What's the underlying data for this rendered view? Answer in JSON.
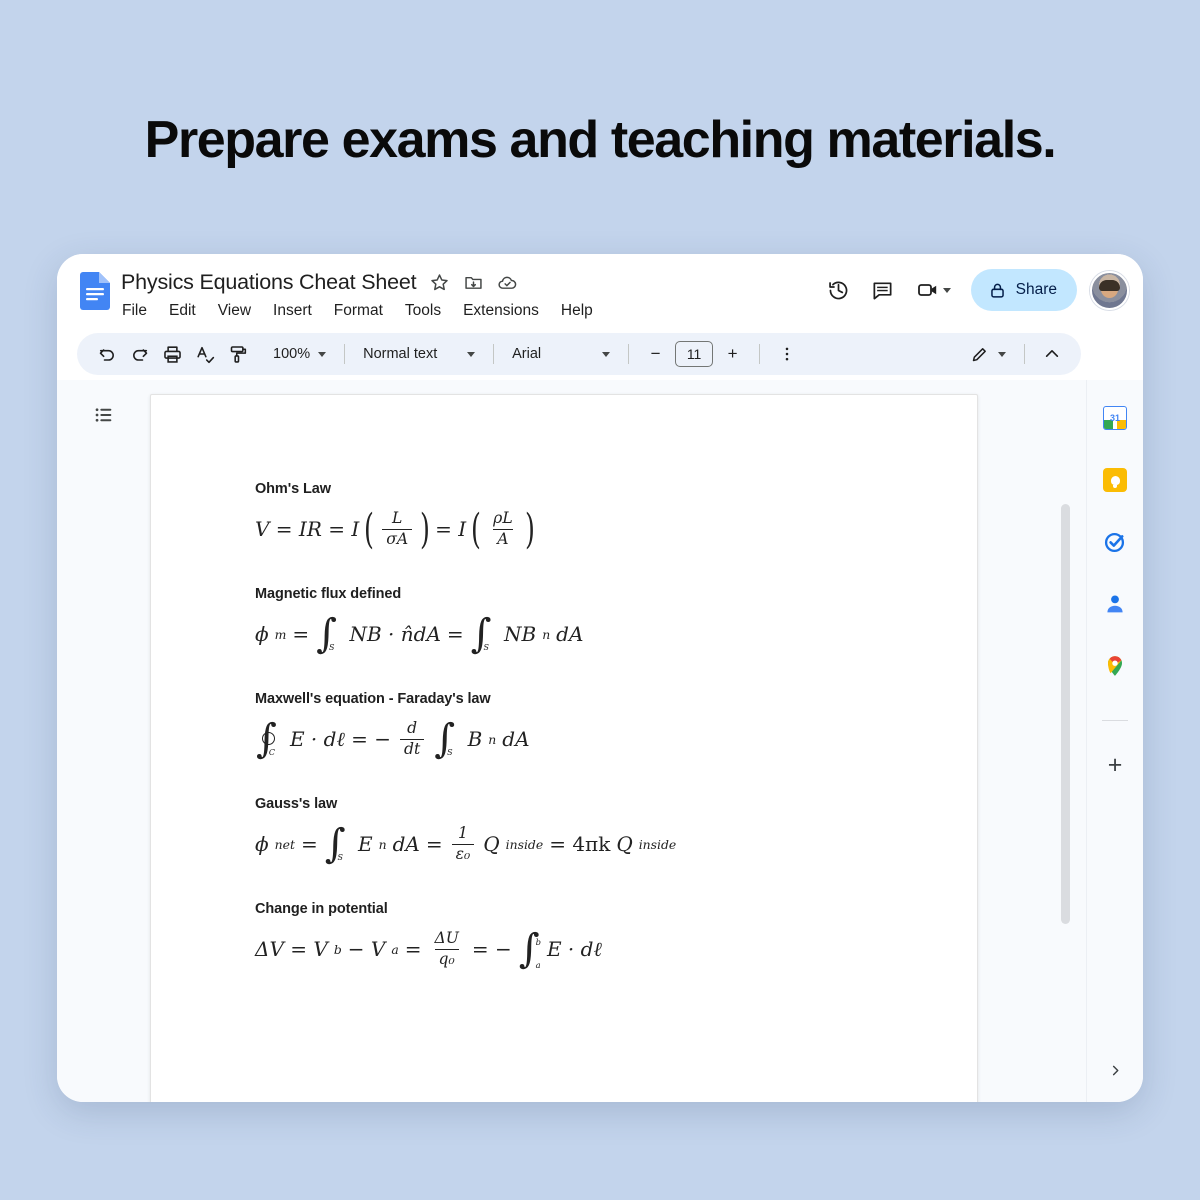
{
  "headline": "Prepare exams and teaching materials.",
  "app": {
    "logo_icon": "google-docs-icon",
    "doc_title": "Physics Equations Cheat Sheet",
    "title_icons": [
      {
        "name": "star-icon",
        "label": "Star"
      },
      {
        "name": "move-to-folder-icon",
        "label": "Move"
      },
      {
        "name": "cloud-saved-icon",
        "label": "Saved to Drive"
      }
    ],
    "menus": [
      "File",
      "Edit",
      "View",
      "Insert",
      "Format",
      "Tools",
      "Extensions",
      "Help"
    ],
    "header_actions": [
      {
        "name": "version-history-icon",
        "label": "Version history"
      },
      {
        "name": "comment-icon",
        "label": "Comments"
      },
      {
        "name": "meet-camera-icon",
        "label": "Join a call"
      }
    ],
    "share": {
      "label": "Share",
      "icon": "lock-icon",
      "bg": "#c2e7ff",
      "fg": "#041e49"
    },
    "avatar": {
      "name": "user-avatar",
      "label": "Account"
    }
  },
  "toolbar": {
    "undo_label": "Undo",
    "redo_label": "Redo",
    "print_label": "Print",
    "spelling_label": "Spelling and grammar check",
    "paint_label": "Paint format",
    "zoom_value": "100%",
    "style_value": "Normal text",
    "font_value": "Arial",
    "font_size_decrease": "−",
    "font_size_value": "11",
    "font_size_increase": "+",
    "more_label": "More",
    "editing_mode_label": "Editing mode",
    "collapse_label": "Hide the menus"
  },
  "document": {
    "outline_label": "Show document outline",
    "equations": [
      {
        "heading": "Ohm's Law",
        "latex": "V = IR = I ( L / (σA) ) = I ( ρL / A )",
        "parts": {
          "lhs": "V = IR = I",
          "frac1_num": "L",
          "frac1_den": "σA",
          "mid": "= I",
          "frac2_num": "ρL",
          "frac2_den": "A"
        }
      },
      {
        "heading": "Magnetic flux defined",
        "latex": "φₘ = ∫_S NB·n̂ dA = ∫_S NBₙ dA",
        "parts": {
          "lhs_sym": "ϕ",
          "lhs_sub": "m",
          "eq1": "=",
          "int1_sub": "S",
          "expr1": "NB · n̂dA",
          "eq2": "=",
          "int2_sub": "S",
          "expr2": "NB",
          "expr2_sub": "n",
          "expr2_tail": "dA"
        }
      },
      {
        "heading": "Maxwell's equation - Faraday's law",
        "latex": "∮_C E·dℓ = -(d/dt) ∫_S Bₙ dA",
        "parts": {
          "oint_sub": "C",
          "expr1": "E · dℓ  =  −",
          "frac_num": "d",
          "frac_den": "dt",
          "int_sub": "S",
          "expr2": "B",
          "expr2_sub": "n",
          "expr2_tail": "dA"
        }
      },
      {
        "heading": "Gauss's law",
        "latex": "φ_net = ∫_S Eₙ dA = (1/ε₀) Q_inside = 4πk Q_inside",
        "parts": {
          "lhs_sym": "ϕ",
          "lhs_sub": "net",
          "eq1": "=",
          "int_sub": "S",
          "expr1": "E",
          "expr1_sub": "n",
          "expr1_tail": "dA",
          "eq2": "=",
          "frac_num": "1",
          "frac_den": "ε₀",
          "q1": "Q",
          "q1_sub": "inside",
          "eq3": "= 4πk",
          "q2": "Q",
          "q2_sub": "inside"
        }
      },
      {
        "heading": "Change in potential",
        "latex": "ΔV = V_b − V_a = ΔU/q₀ = −∫_a^b E·dℓ",
        "parts": {
          "lhs": "ΔV = V",
          "lhs_sub1": "b",
          "minus": "− V",
          "lhs_sub2": "a",
          "eq1": "=",
          "frac_num": "ΔU",
          "frac_den": "q₀",
          "eq2": "= −",
          "int_up": "b",
          "int_lo": "a",
          "expr": "E · dℓ"
        }
      }
    ]
  },
  "side_rail": {
    "items": [
      {
        "name": "google-calendar-icon",
        "label": "Calendar",
        "badge": "31"
      },
      {
        "name": "google-keep-icon",
        "label": "Keep"
      },
      {
        "name": "google-tasks-icon",
        "label": "Tasks"
      },
      {
        "name": "google-contacts-icon",
        "label": "Contacts"
      },
      {
        "name": "google-maps-icon",
        "label": "Maps"
      }
    ],
    "add_label": "Get add-ons",
    "expand_label": "Show side panel"
  },
  "colors": {
    "page_bg": "#c3d4ec",
    "toolbar_bg": "#edf2fa",
    "share_bg": "#c2e7ff",
    "docs_blue": "#4285f4"
  }
}
